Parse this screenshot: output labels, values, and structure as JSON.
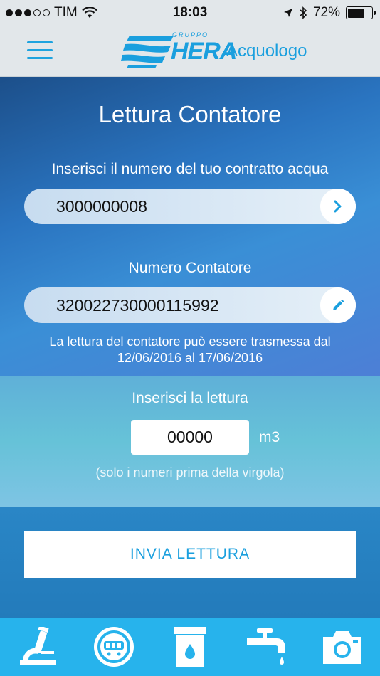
{
  "status_bar": {
    "carrier": "TIM",
    "time": "18:03",
    "battery": "72%",
    "battery_level": 0.72
  },
  "header": {
    "gruppo": "GRUPPO",
    "brand": "HERA",
    "app_name": "Acquologo"
  },
  "main": {
    "title": "Lettura Contatore",
    "contract_label": "Inserisci il numero del tuo contratto acqua",
    "contract_value": "3000000008",
    "meter_label": "Numero Contatore",
    "meter_value": "320022730000115992",
    "note_line1": "La lettura del contatore può essere trasmessa dal",
    "note_line2": "12/06/2016 al 17/06/2016"
  },
  "reading": {
    "label": "Inserisci la lettura",
    "value": "00000",
    "unit": "m3",
    "hint": "(solo i numeri prima della virgola)"
  },
  "submit": {
    "label": "INVIA LETTURA"
  },
  "tabs": [
    {
      "icon": "microscope-icon"
    },
    {
      "icon": "meter-icon",
      "active": true
    },
    {
      "icon": "water-tank-icon"
    },
    {
      "icon": "faucet-icon"
    },
    {
      "icon": "camera-icon"
    }
  ],
  "colors": {
    "accent": "#1a9fde",
    "tabbar": "#27b3ec",
    "gradient_dark": "#1c4f8a"
  }
}
